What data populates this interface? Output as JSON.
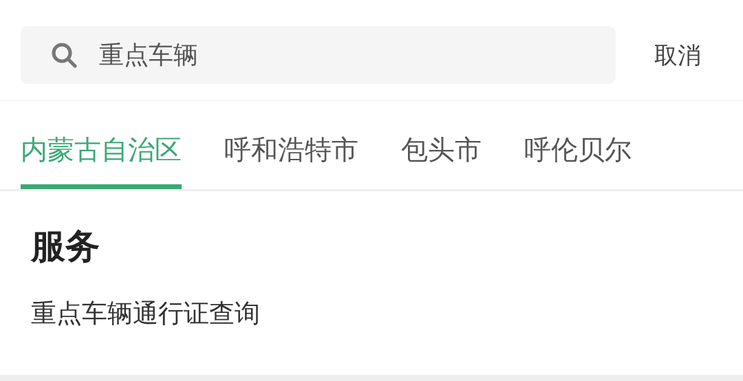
{
  "search": {
    "value": "重点车辆",
    "cancel": "取消"
  },
  "tabs": [
    {
      "label": "内蒙古自治区",
      "selected": true
    },
    {
      "label": "呼和浩特市",
      "selected": false
    },
    {
      "label": "包头市",
      "selected": false
    },
    {
      "label": "呼伦贝尔",
      "selected": false
    }
  ],
  "section": {
    "title": "服务",
    "items": [
      "重点车辆通行证查询"
    ]
  }
}
